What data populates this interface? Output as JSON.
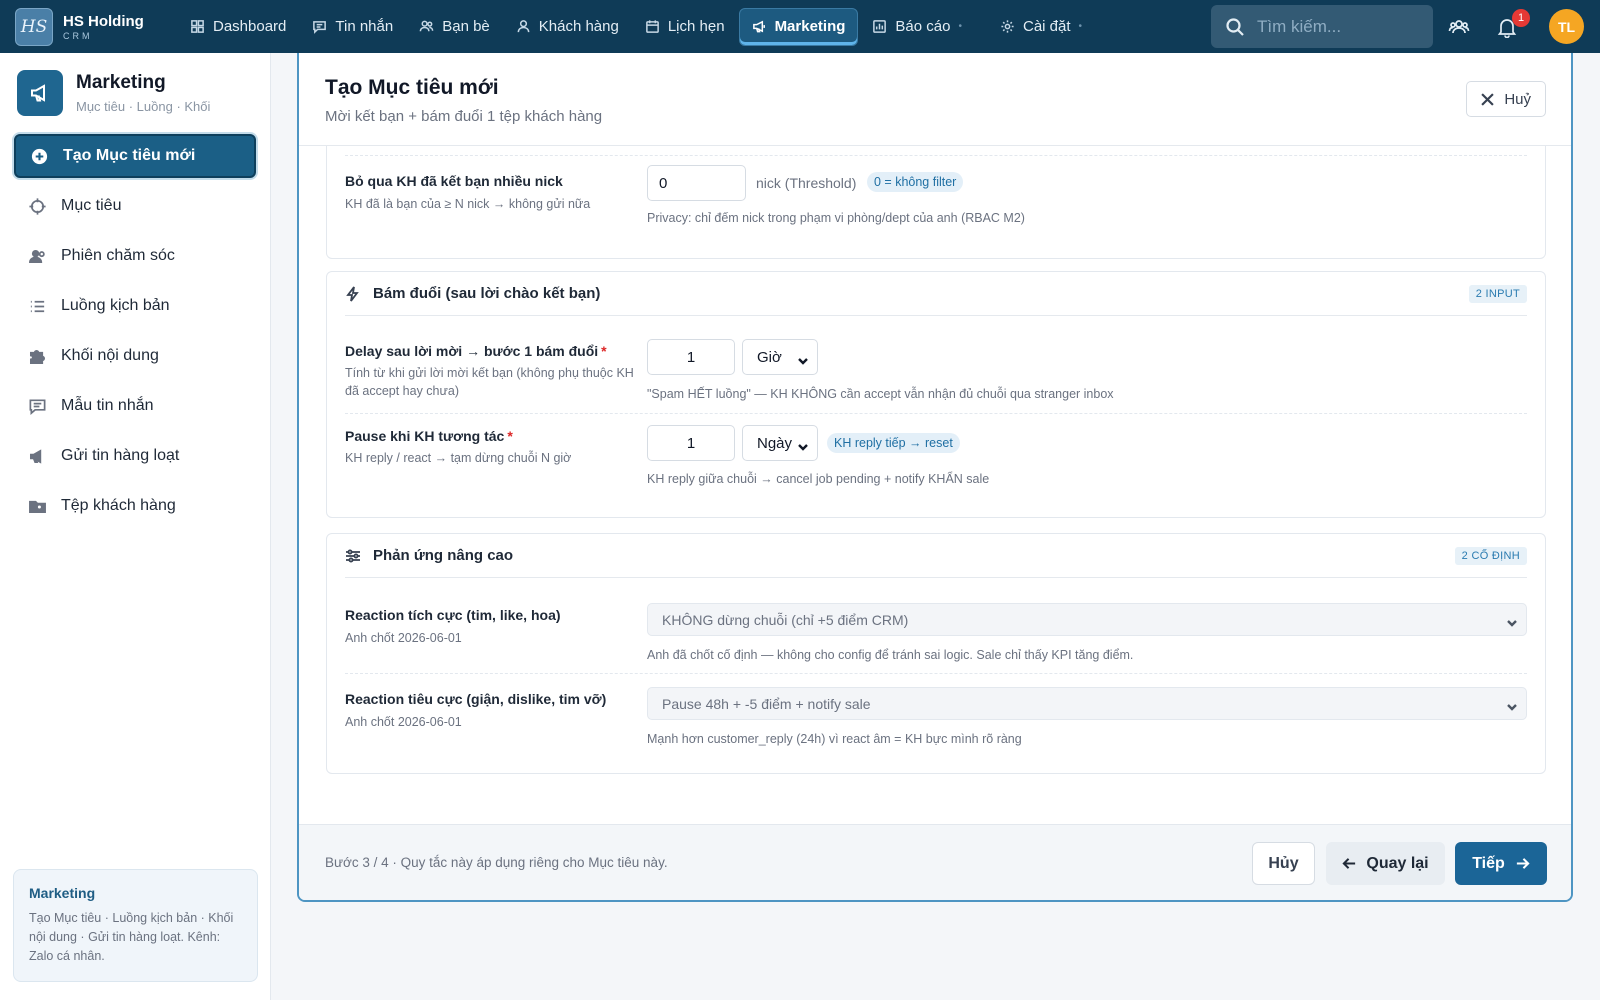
{
  "brand": {
    "name": "HS Holding",
    "sub": "CRM",
    "logo_text": "HS"
  },
  "nav": {
    "items": [
      {
        "label": "Dashboard",
        "icon": "grid-icon"
      },
      {
        "label": "Tin nhắn",
        "icon": "message-icon"
      },
      {
        "label": "Bạn bè",
        "icon": "friends-icon"
      },
      {
        "label": "Khách hàng",
        "icon": "user-icon"
      },
      {
        "label": "Lịch hẹn",
        "icon": "calendar-icon"
      },
      {
        "label": "Marketing",
        "icon": "megaphone-icon",
        "active": true
      },
      {
        "label": "Báo cáo",
        "icon": "report-icon"
      },
      {
        "label": "Cài đặt",
        "icon": "gear-icon"
      }
    ]
  },
  "search": {
    "placeholder": "Tìm kiếm..."
  },
  "notifications": {
    "count": "1"
  },
  "user": {
    "initials": "TL"
  },
  "sidebar": {
    "title": "Marketing",
    "subtitle": "Mục tiêu · Luồng · Khối",
    "items": [
      {
        "label": "Tạo Mục tiêu mới",
        "icon": "plus-circle-icon",
        "active": true
      },
      {
        "label": "Mục tiêu",
        "icon": "crosshair-icon"
      },
      {
        "label": "Phiên chăm sóc",
        "icon": "users-icon"
      },
      {
        "label": "Luồng kịch bản",
        "icon": "list-icon"
      },
      {
        "label": "Khối nội dung",
        "icon": "puzzle-icon"
      },
      {
        "label": "Mẫu tin nhắn",
        "icon": "message-template-icon"
      },
      {
        "label": "Gửi tin hàng loạt",
        "icon": "broadcast-icon"
      },
      {
        "label": "Tệp khách hàng",
        "icon": "folder-user-icon"
      }
    ],
    "info": {
      "title": "Marketing",
      "text": "Tạo Mục tiêu · Luồng kịch bản · Khối nội dung · Gửi tin hàng loạt. Kênh: Zalo cá nhân."
    }
  },
  "page": {
    "title": "Tạo Mục tiêu mới",
    "subtitle": "Mời kết bạn + bám đuổi 1 tệp khách hàng",
    "cancel_label": "Huỷ"
  },
  "section_skip": {
    "label": "Bỏ qua KH đã kết bạn nhiều nick",
    "sub": "KH đã là bạn của ≥ N nick → không gửi nữa",
    "value": "0",
    "unit": "nick (Threshold)",
    "pill": "0 = không filter",
    "hint": "Privacy: chỉ đếm nick trong phạm vi phòng/dept của anh (RBAC M2)"
  },
  "section_follow": {
    "title": "Bám đuổi (sau lời chào kết bạn)",
    "tag": "2 INPUT",
    "rows": [
      {
        "label": "Delay sau lời mời → bước 1 bám đuổi",
        "required": "*",
        "sub": "Tính từ khi gửi lời mời kết bạn (không phụ thuộc KH đã accept hay chưa)",
        "value": "1",
        "unit": "Giờ",
        "hint": "\"Spam HẾT luồng\" — KH KHÔNG cần accept vẫn nhận đủ chuỗi qua stranger inbox"
      },
      {
        "label": "Pause khi KH tương tác",
        "required": "*",
        "sub": "KH reply / react → tạm dừng chuỗi N giờ",
        "value": "1",
        "unit": "Ngày",
        "pill": "KH reply tiếp → reset",
        "hint": "KH reply giữa chuỗi → cancel job pending + notify KHẨN sale"
      }
    ]
  },
  "section_reaction": {
    "title": "Phản ứng nâng cao",
    "tag": "2 CỐ ĐỊNH",
    "rows": [
      {
        "label": "Reaction tích cực (tim, like, hoa)",
        "sub": "Anh chốt 2026-06-01",
        "value": "KHÔNG dừng chuỗi (chỉ +5 điểm CRM)",
        "hint": "Anh đã chốt cố định — không cho config để tránh sai logic. Sale chỉ thấy KPI tăng điểm."
      },
      {
        "label": "Reaction tiêu cực (giận, dislike, tim vỡ)",
        "sub": "Anh chốt 2026-06-01",
        "value": "Pause 48h + -5 điểm + notify sale",
        "hint": "Mạnh hơn customer_reply (24h) vì react âm = KH bực mình rõ ràng"
      }
    ]
  },
  "footer": {
    "note": "Bước 3 / 4 · Quy tắc này áp dụng riêng cho Mục tiêu này.",
    "cancel": "Hủy",
    "back": "Quay lại",
    "next": "Tiếp"
  },
  "colors": {
    "topbar": "#0f3b57",
    "accent": "#1b6597",
    "active_nav": "#1d5a80"
  }
}
